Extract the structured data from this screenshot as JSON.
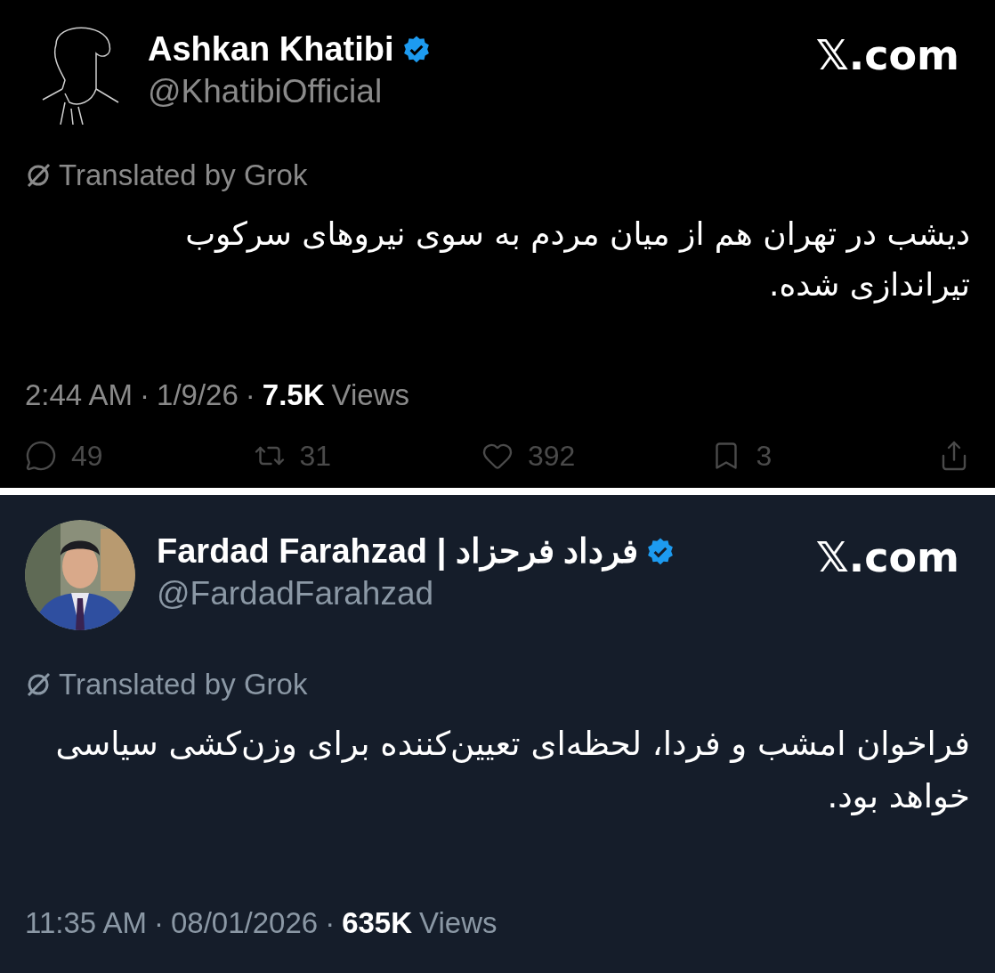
{
  "tweets": [
    {
      "kind": "black",
      "avatar": {
        "kind": "drawing"
      },
      "name": "Ashkan Khatibi",
      "verified": true,
      "handle": "@KhatibiOfficial",
      "site": "𝕏.com",
      "translated": "Translated by Grok",
      "text": "دیشب در تهران هم از میان مردم به سوی نیروهای سرکوب تیراندازی شده.",
      "time": "2:44 AM",
      "separator": "·",
      "date": "1/9/26",
      "views_count": "7.5K",
      "views_label": "Views",
      "actions": [
        {
          "kind": "reply",
          "count": "49"
        },
        {
          "kind": "repost",
          "count": "31"
        },
        {
          "kind": "like",
          "count": "392"
        },
        {
          "kind": "bookmark",
          "count": "3"
        },
        {
          "kind": "share"
        }
      ]
    },
    {
      "kind": "dim",
      "name": "Fardad Farahzad | فرداد فرحزاد",
      "verified": true,
      "handle": "@FardadFarahzad",
      "site": "𝕏.com",
      "translated": "Translated by Grok",
      "text": "فراخوان امشب و فردا، لحظه‌ای تعیین‌کننده برای وزن‌کشی سیاسی خواهد بود.",
      "time": "11:35 AM",
      "separator": "·",
      "date": "08/01/2026",
      "views_count": "635K",
      "views_label": "Views"
    }
  ]
}
